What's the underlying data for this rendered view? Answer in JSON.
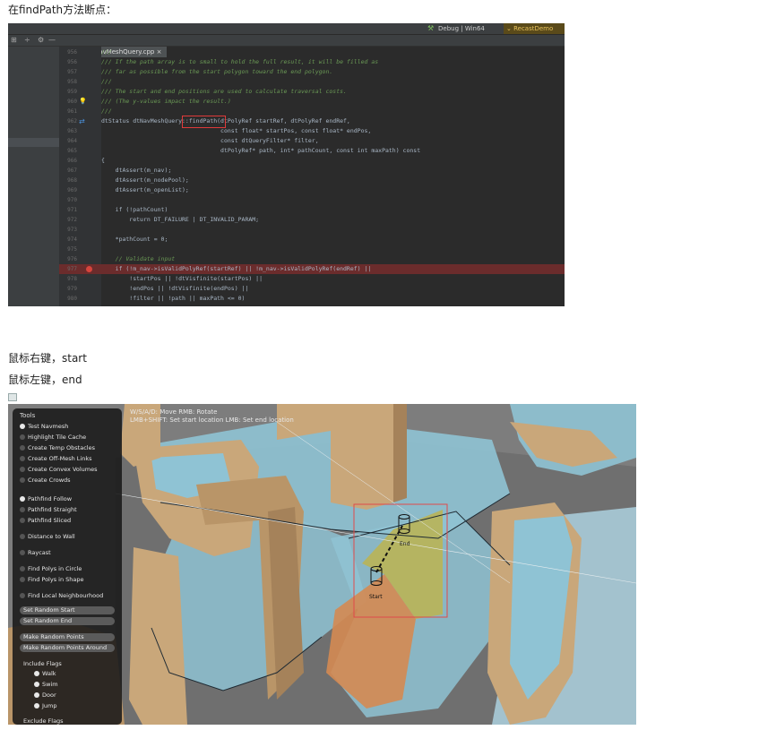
{
  "captions": {
    "title": "在findPath方法断点：",
    "right_click": "鼠标右键，start",
    "left_click": "鼠标左键，end"
  },
  "ide": {
    "debug_config": "Debug | Win64",
    "run_config": "RecastDemo",
    "file_tab": "DetourNavMeshQuery.cpp",
    "colors": {
      "background": "#2b2b2b",
      "comment": "#6a9955",
      "breakpoint_row": "#6b2c2c",
      "breakpoint_dot": "#d6453d"
    },
    "lines": [
      {
        "no": "956",
        "text": "///",
        "kind": "comment"
      },
      {
        "no": "956",
        "text": "/// If the path array is to small to hold the full result, it will be filled as",
        "kind": "comment"
      },
      {
        "no": "957",
        "text": "/// far as possible from the start polygon toward the end polygon.",
        "kind": "comment"
      },
      {
        "no": "958",
        "text": "///",
        "kind": "comment"
      },
      {
        "no": "959",
        "text": "/// The start and end positions are used to calculate traversal costs.",
        "kind": "comment"
      },
      {
        "no": "960",
        "text": "/// (The y-values impact the result.)",
        "kind": "comment"
      },
      {
        "no": "961",
        "text": "///",
        "kind": "comment"
      },
      {
        "no": "962",
        "text": "dtStatus dtNavMeshQuery::findPath(dtPolyRef startRef, dtPolyRef endRef,",
        "kind": "code"
      },
      {
        "no": "963",
        "text": "                                  const float* startPos, const float* endPos,",
        "kind": "code"
      },
      {
        "no": "964",
        "text": "                                  const dtQueryFilter* filter,",
        "kind": "code"
      },
      {
        "no": "965",
        "text": "                                  dtPolyRef* path, int* pathCount, const int maxPath) const",
        "kind": "code"
      },
      {
        "no": "966",
        "text": "{",
        "kind": "code"
      },
      {
        "no": "967",
        "text": "    dtAssert(m_nav);",
        "kind": "code"
      },
      {
        "no": "968",
        "text": "    dtAssert(m_nodePool);",
        "kind": "code"
      },
      {
        "no": "969",
        "text": "    dtAssert(m_openList);",
        "kind": "code"
      },
      {
        "no": "970",
        "text": "",
        "kind": "code"
      },
      {
        "no": "971",
        "text": "    if (!pathCount)",
        "kind": "code"
      },
      {
        "no": "972",
        "text": "        return DT_FAILURE | DT_INVALID_PARAM;",
        "kind": "code"
      },
      {
        "no": "973",
        "text": "",
        "kind": "code"
      },
      {
        "no": "974",
        "text": "    *pathCount = 0;",
        "kind": "code"
      },
      {
        "no": "975",
        "text": "",
        "kind": "code"
      },
      {
        "no": "976",
        "text": "    // Validate input",
        "kind": "comment"
      },
      {
        "no": "977",
        "text": "    if (!m_nav->isValidPolyRef(startRef) || !m_nav->isValidPolyRef(endRef) ||",
        "kind": "breakpoint"
      },
      {
        "no": "978",
        "text": "        !startPos || !dtVisfinite(startPos) ||",
        "kind": "code"
      },
      {
        "no": "979",
        "text": "        !endPos || !dtVisfinite(endPos) ||",
        "kind": "code"
      },
      {
        "no": "980",
        "text": "        !filter || !path || maxPath <= 0)",
        "kind": "code"
      }
    ]
  },
  "recast": {
    "info_line1": "W/S/A/D: Move  RMB: Rotate",
    "info_line2": "LMB+SHIFT: Set start location  LMB: Set end location",
    "panel_title": "Tools",
    "tools": [
      {
        "label": "Test Navmesh",
        "on": true
      },
      {
        "label": "Highlight Tile Cache",
        "on": false
      },
      {
        "label": "Create Temp Obstacles",
        "on": false
      },
      {
        "label": "Create Off-Mesh Links",
        "on": false
      },
      {
        "label": "Create Convex Volumes",
        "on": false
      },
      {
        "label": "Create Crowds",
        "on": false
      }
    ],
    "modes": [
      {
        "label": "Pathfind Follow",
        "on": true
      },
      {
        "label": "Pathfind Straight",
        "on": false
      },
      {
        "label": "Pathfind Sliced",
        "on": false
      },
      {
        "label": "Distance to Wall",
        "on": false
      },
      {
        "label": "Raycast",
        "on": false
      },
      {
        "label": "Find Polys in Circle",
        "on": false
      },
      {
        "label": "Find Polys in Shape",
        "on": false
      },
      {
        "label": "Find Local Neighbourhood",
        "on": false
      }
    ],
    "buttons": [
      "Set Random Start",
      "Set Random End",
      "Make Random Points",
      "Make Random Points Around"
    ],
    "include_flags_title": "Include Flags",
    "include_flags": [
      "Walk",
      "Swim",
      "Door",
      "Jump"
    ],
    "exclude_flags_title": "Exclude Flags",
    "start_label": "Start",
    "end_label": "End",
    "colors": {
      "navmesh": "#8fc3d4",
      "walls": "#c9a77a",
      "path_start_poly": "#d48a52",
      "path_end_poly": "#a8a84a"
    }
  }
}
